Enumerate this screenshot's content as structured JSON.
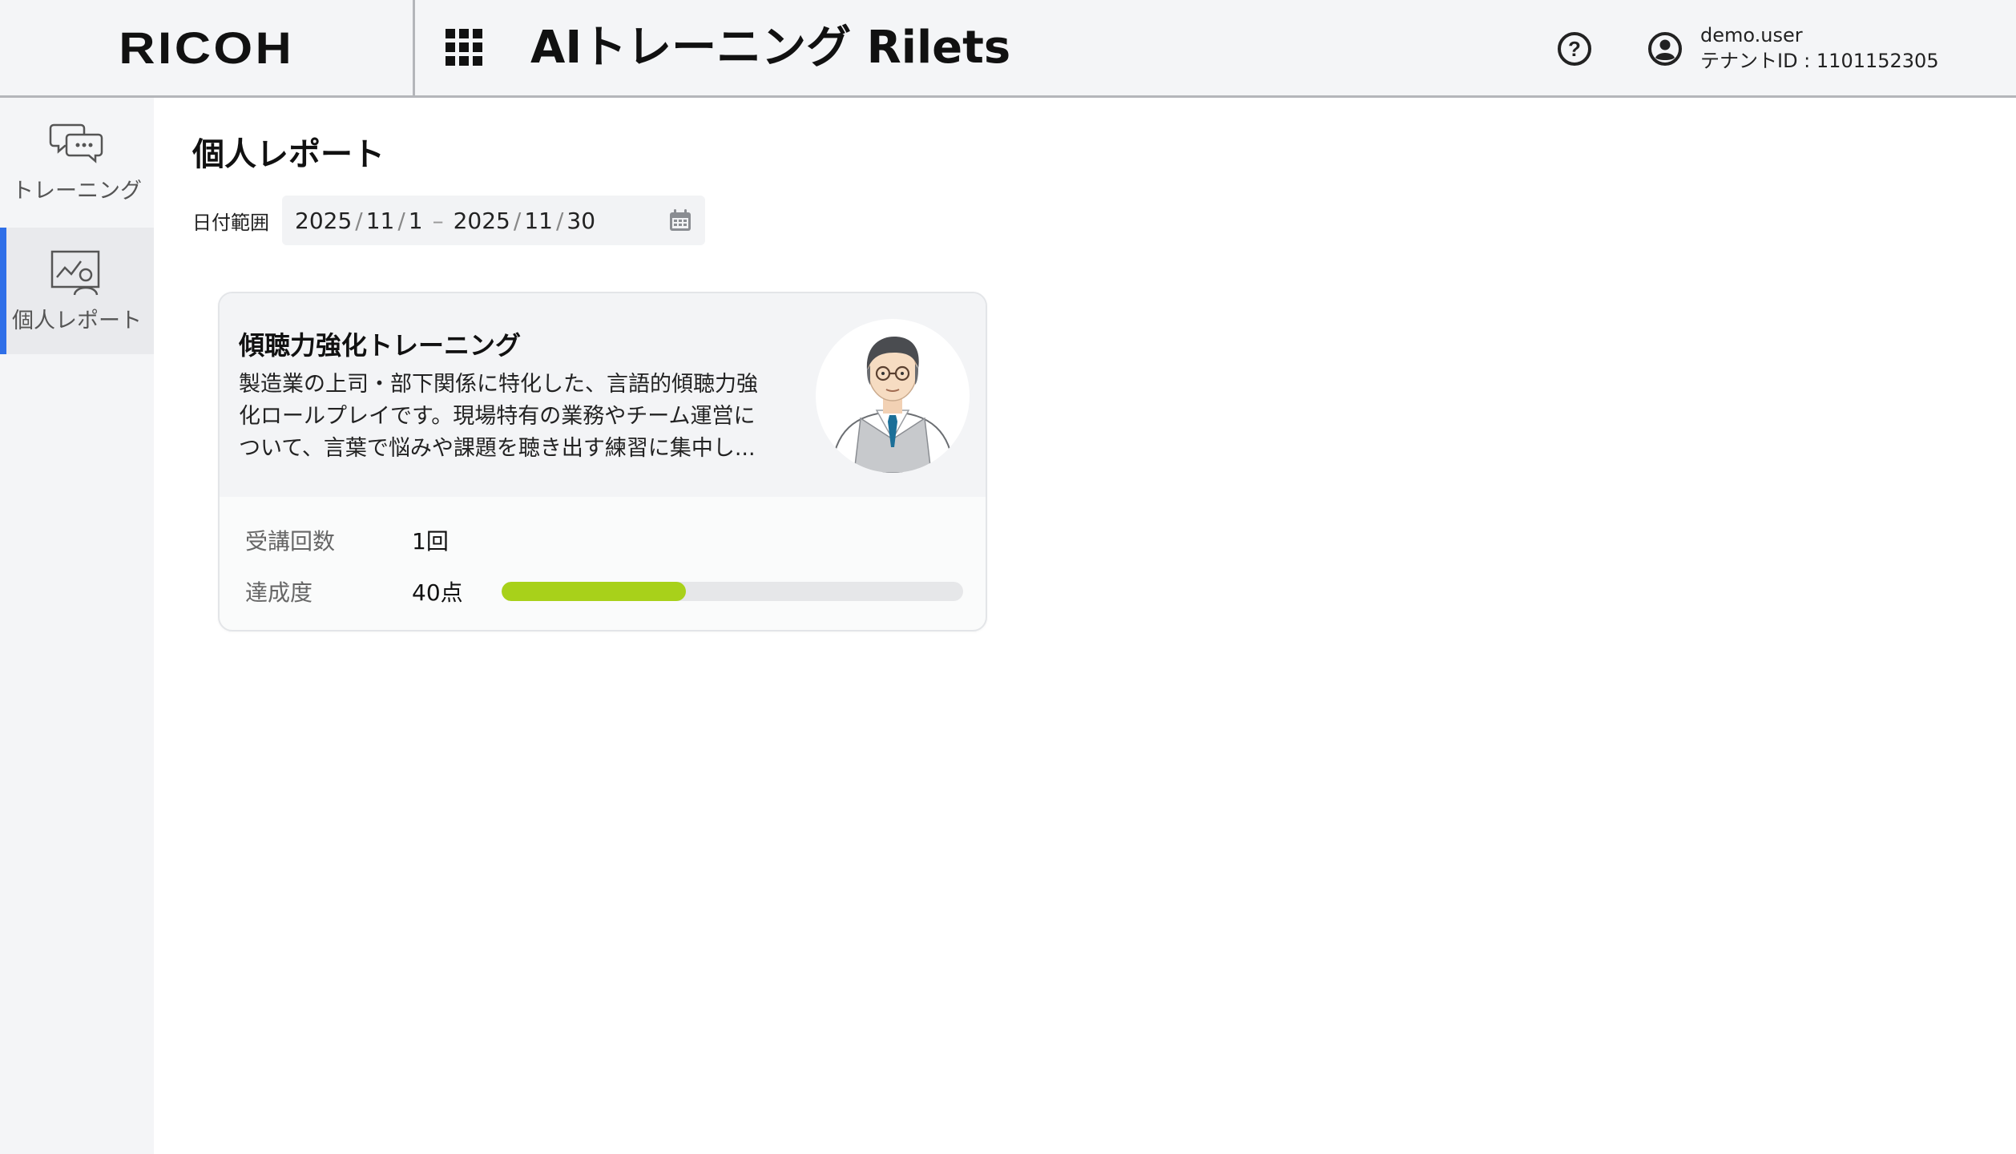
{
  "header": {
    "logo": "RICOH",
    "app_title": "AIトレーニング Rilets",
    "help_symbol": "?",
    "user": {
      "name": "demo.user",
      "tenant": "テナントID : 1101152305"
    }
  },
  "sidebar": {
    "items": [
      {
        "label": "トレーニング",
        "icon": "chat-bubbles-icon",
        "active": false
      },
      {
        "label": "個人レポート",
        "icon": "report-chart-person-icon",
        "active": true
      }
    ]
  },
  "main": {
    "title": "個人レポート",
    "date_filter": {
      "label": "日付範囲",
      "start": {
        "year": "2025",
        "month": "11",
        "day": "1"
      },
      "end": {
        "year": "2025",
        "month": "11",
        "day": "30"
      },
      "separator": "/",
      "range_dash": "–"
    },
    "card": {
      "title": "傾聴力強化トレーニング",
      "description_lines": [
        "製造業の上司・部下関係に特化した、言語的傾聴力強",
        "化ロールプレイです。現場特有の業務やチーム運営に",
        "ついて、言葉で悩みや課題を聴き出す練習に集中し..."
      ],
      "stats": {
        "attendance_label": "受講回数",
        "attendance_value": "1回",
        "achievement_label": "達成度",
        "achievement_value": "40点",
        "achievement_fraction": 0.4
      }
    }
  },
  "colors": {
    "accent": "#2f6fe8",
    "progress": "#a8d11a",
    "header_bg": "#f4f5f7"
  }
}
